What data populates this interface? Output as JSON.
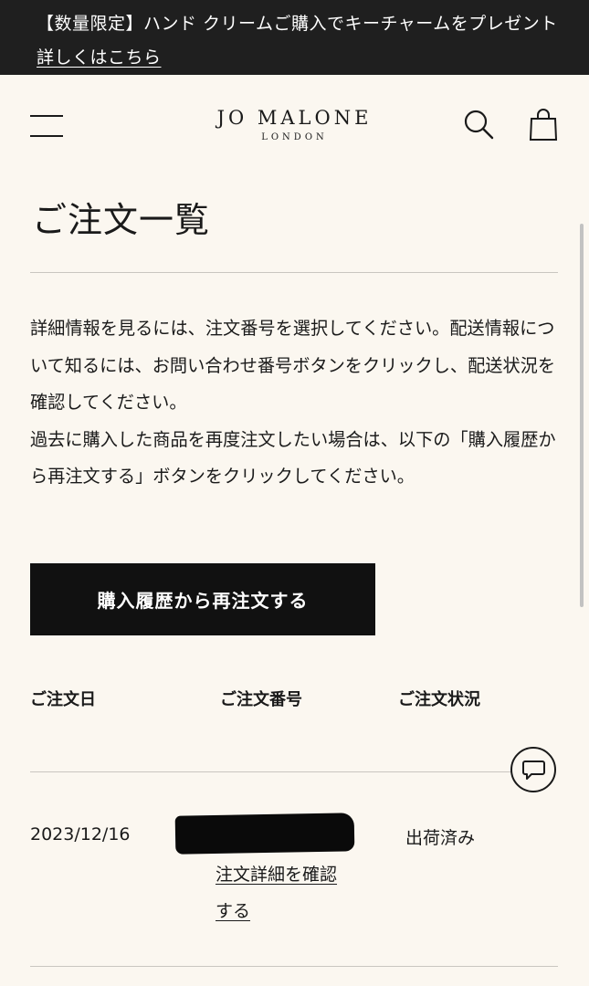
{
  "promo": {
    "text": "【数量限定】ハンド クリームご購入でキーチャームをプレゼント ",
    "link_label": "詳しくはこちら"
  },
  "header": {
    "brand": "JO MALONE",
    "brand_sub": "LONDON",
    "icons": [
      "menu-icon",
      "search-icon",
      "shopping-bag-icon"
    ]
  },
  "page": {
    "title": "ご注文一覧",
    "intro_lines": [
      "詳細情報を見るには、注文番号を選択してください。配送情報について知るには、お問い合わせ番号ボタンをクリックし、配送状況を確認してください。",
      "過去に購入した商品を再度注文したい場合は、以下の「購入履歴から再注文する」ボタンをクリックしてください。"
    ],
    "reorder_button": "購入履歴から再注文する"
  },
  "orders": {
    "columns": [
      "ご注文日",
      "ご注文番号",
      "ご注文状況"
    ],
    "rows": [
      {
        "date": "2023/12/16",
        "status": "出荷済み",
        "detail_link": "注文詳細を確認する"
      }
    ]
  },
  "chat": {
    "icon": "chat-bubble-icon"
  }
}
